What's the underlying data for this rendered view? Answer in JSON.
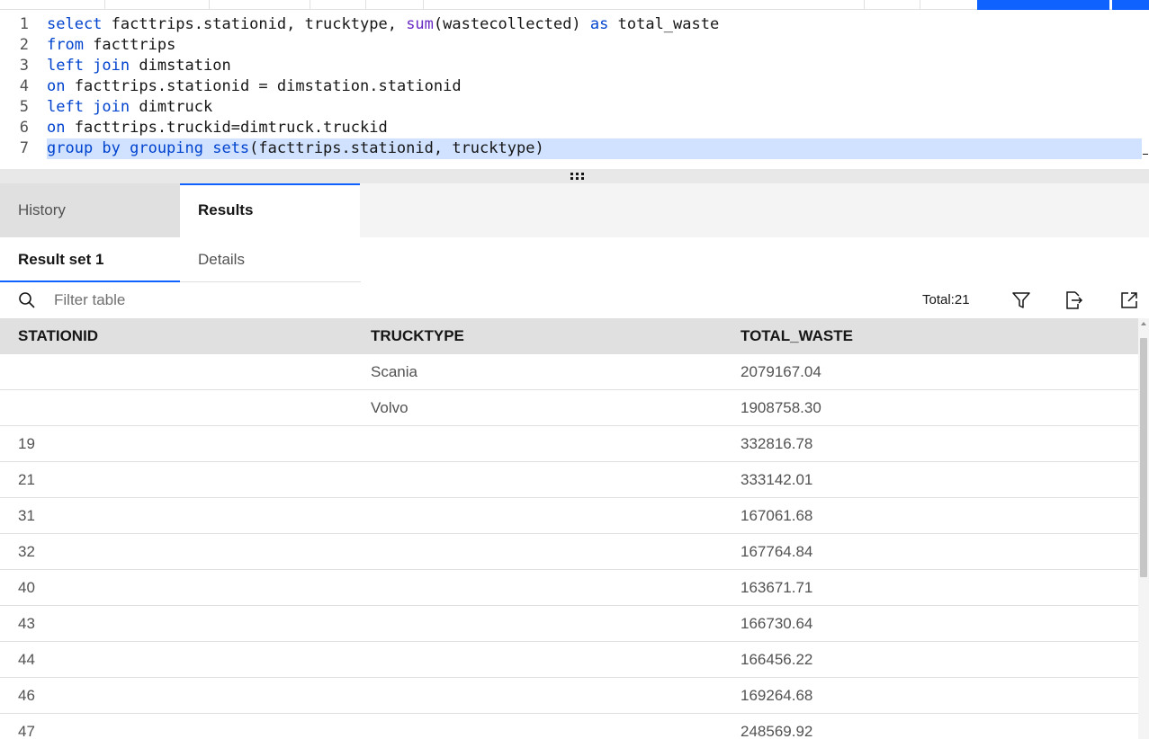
{
  "editor": {
    "lines": [
      {
        "num": "1",
        "tokens": [
          [
            "kw",
            "select"
          ],
          [
            "",
            " facttrips.stationid, trucktype, "
          ],
          [
            "fn",
            "sum"
          ],
          [
            "",
            "(wastecollected) "
          ],
          [
            "kw",
            "as"
          ],
          [
            "",
            " total_waste"
          ]
        ]
      },
      {
        "num": "2",
        "tokens": [
          [
            "kw",
            "from"
          ],
          [
            "",
            " facttrips"
          ]
        ]
      },
      {
        "num": "3",
        "tokens": [
          [
            "kw",
            "left join"
          ],
          [
            "",
            " dimstation"
          ]
        ]
      },
      {
        "num": "4",
        "tokens": [
          [
            "kw",
            "on"
          ],
          [
            "",
            " facttrips.stationid = dimstation.stationid"
          ]
        ]
      },
      {
        "num": "5",
        "tokens": [
          [
            "kw",
            "left join"
          ],
          [
            "",
            " dimtruck"
          ]
        ]
      },
      {
        "num": "6",
        "tokens": [
          [
            "kw",
            "on"
          ],
          [
            "",
            " facttrips.truckid=dimtruck.truckid"
          ]
        ]
      },
      {
        "num": "7",
        "tokens": [
          [
            "kw",
            "group by grouping sets"
          ],
          [
            "",
            "(facttrips.stationid, trucktype)"
          ]
        ]
      }
    ],
    "selected_line": "7"
  },
  "tabs": {
    "history_label": "History",
    "results_label": "Results"
  },
  "subtabs": {
    "result_set_label": "Result set 1",
    "details_label": "Details"
  },
  "filter": {
    "placeholder": "Filter table",
    "value": "",
    "total_label": "Total:21"
  },
  "table": {
    "columns": [
      "STATIONID",
      "TRUCKTYPE",
      "TOTAL_WASTE"
    ],
    "rows": [
      [
        "",
        "Scania",
        "2079167.04"
      ],
      [
        "",
        "Volvo",
        "1908758.30"
      ],
      [
        "19",
        "",
        "332816.78"
      ],
      [
        "21",
        "",
        "333142.01"
      ],
      [
        "31",
        "",
        "167061.68"
      ],
      [
        "32",
        "",
        "167764.84"
      ],
      [
        "40",
        "",
        "163671.71"
      ],
      [
        "43",
        "",
        "166730.64"
      ],
      [
        "44",
        "",
        "166456.22"
      ],
      [
        "46",
        "",
        "169264.68"
      ],
      [
        "47",
        "",
        "248569.92"
      ]
    ]
  },
  "icons": {
    "search": "search-icon",
    "filter": "filter-icon",
    "export": "export-icon",
    "launch": "launch-icon",
    "drag_handle": "drag-handle-icon"
  },
  "colors": {
    "accent": "#0f62fe",
    "keyword": "#0043ce",
    "function": "#6929c4",
    "selection": "#d0e2ff"
  }
}
